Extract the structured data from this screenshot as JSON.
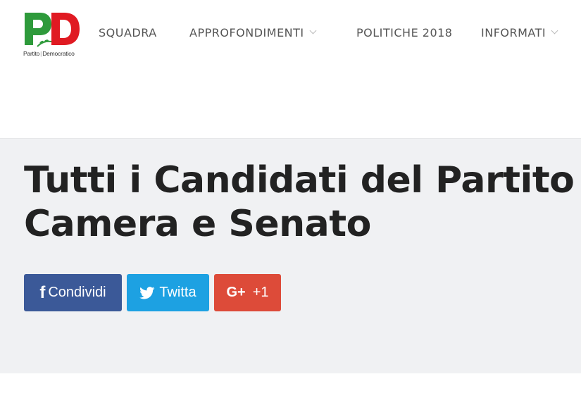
{
  "logo": {
    "letters": "PD",
    "text_left": "Partito",
    "text_right": "Democratico",
    "colors": {
      "green": "#2e9a3b",
      "red": "#e01a22"
    }
  },
  "nav": {
    "items": [
      {
        "label": "SQUADRA",
        "has_dropdown": false
      },
      {
        "label": "APPROFONDIMENTI",
        "has_dropdown": true
      },
      {
        "label": "POLITICHE 2018",
        "has_dropdown": false
      },
      {
        "label": "INFORMATI",
        "has_dropdown": true
      }
    ]
  },
  "hero": {
    "title_line1": "Tutti i Candidati del Partito",
    "title_line2": "Camera e Senato"
  },
  "share": {
    "facebook": {
      "icon": "facebook-icon",
      "label": "Condividi",
      "color": "#3b5998"
    },
    "twitter": {
      "icon": "twitter-icon",
      "label": "Twitta",
      "color": "#1da1e2"
    },
    "googleplus": {
      "icon": "google-plus-icon",
      "icon_text": "G+",
      "label": "+1",
      "color": "#dd4b39"
    }
  }
}
